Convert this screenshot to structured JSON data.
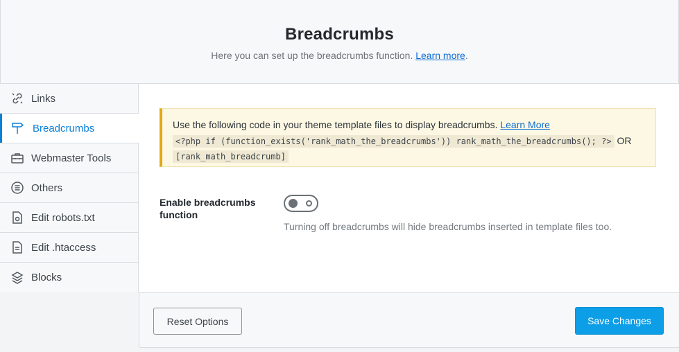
{
  "header": {
    "title": "Breadcrumbs",
    "subtitle": "Here you can set up the breadcrumbs function.",
    "learn_more": "Learn more",
    "period": "."
  },
  "sidebar": {
    "items": [
      {
        "label": "Links",
        "icon": "link-icon",
        "active": false
      },
      {
        "label": "Breadcrumbs",
        "icon": "signpost-icon",
        "active": true
      },
      {
        "label": "Webmaster Tools",
        "icon": "toolbox-icon",
        "active": false
      },
      {
        "label": "Others",
        "icon": "list-circle-icon",
        "active": false
      },
      {
        "label": "Edit robots.txt",
        "icon": "file-icon",
        "active": false
      },
      {
        "label": "Edit .htaccess",
        "icon": "document-icon",
        "active": false
      },
      {
        "label": "Blocks",
        "icon": "blocks-icon",
        "active": false
      }
    ]
  },
  "notice": {
    "text": "Use the following code in your theme template files to display breadcrumbs.",
    "learn_more": "Learn More",
    "code_php": "<?php if (function_exists('rank_math_the_breadcrumbs')) rank_math_the_breadcrumbs(); ?>",
    "or": "OR",
    "code_shortcode": "[rank_math_breadcrumb]"
  },
  "setting": {
    "label": "Enable breadcrumbs function",
    "enabled": false,
    "description": "Turning off breadcrumbs will hide breadcrumbs inserted in template files too."
  },
  "footer": {
    "reset_label": "Reset Options",
    "save_label": "Save Changes"
  },
  "colors": {
    "accent": "#0c7fd6",
    "save_button": "#0d9ee8",
    "notice_border": "#e1a815",
    "notice_bg": "#fdf8e3"
  }
}
